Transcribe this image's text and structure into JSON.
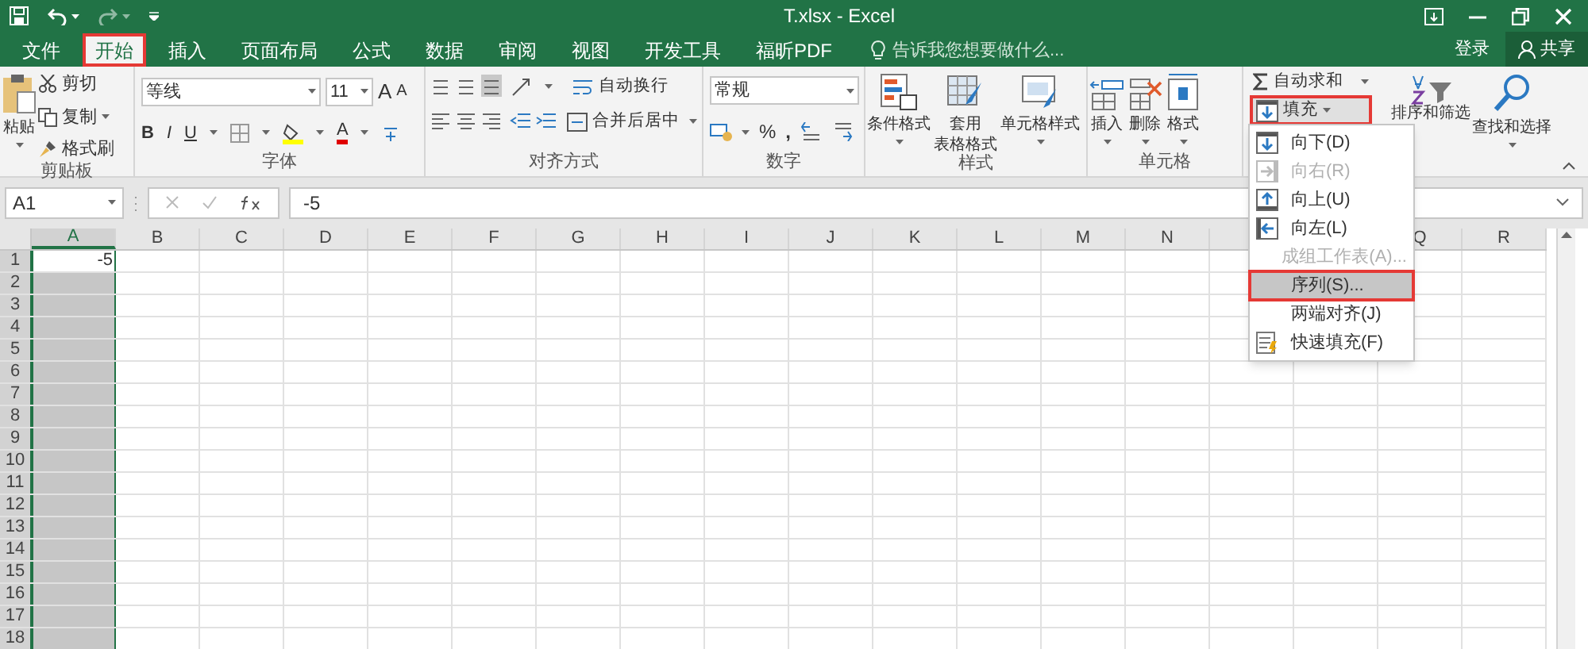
{
  "title_bar": {
    "title": "T.xlsx - Excel"
  },
  "tabs": [
    {
      "label": "文件",
      "selected": false,
      "outlined": false
    },
    {
      "label": "开始",
      "selected": true,
      "outlined": true
    },
    {
      "label": "插入",
      "selected": false,
      "outlined": false
    },
    {
      "label": "页面布局",
      "selected": false,
      "outlined": false
    },
    {
      "label": "公式",
      "selected": false,
      "outlined": false
    },
    {
      "label": "数据",
      "selected": false,
      "outlined": false
    },
    {
      "label": "审阅",
      "selected": false,
      "outlined": false
    },
    {
      "label": "视图",
      "selected": false,
      "outlined": false
    },
    {
      "label": "开发工具",
      "selected": false,
      "outlined": false
    },
    {
      "label": "福昕PDF",
      "selected": false,
      "outlined": false
    }
  ],
  "tell_me": {
    "placeholder": "告诉我您想要做什么..."
  },
  "account": {
    "sign_in": "登录",
    "share": "共享"
  },
  "ribbon": {
    "clipboard": {
      "label": "剪贴板",
      "paste": "粘贴",
      "cut": "剪切",
      "copy": "复制",
      "format_painter": "格式刷"
    },
    "font": {
      "label": "字体",
      "font_name": "等线",
      "font_size": "11",
      "grow": "A",
      "shrink": "A",
      "bold": "B",
      "italic": "I",
      "underline": "U",
      "font_color": "A"
    },
    "alignment": {
      "label": "对齐方式",
      "wrap_text": "自动换行",
      "merge_center": "合并后居中"
    },
    "number": {
      "label": "数字",
      "format": "常规",
      "percent": "%",
      "comma": ","
    },
    "styles": {
      "label": "样式",
      "conditional_formatting": "条件格式",
      "format_as_table": "套用",
      "format_as_table_2": "表格格式",
      "cell_styles": "单元格样式"
    },
    "cells": {
      "label": "单元格",
      "insert": "插入",
      "delete": "删除",
      "format": "格式"
    },
    "editing": {
      "autosum": "自动求和",
      "fill": "填充",
      "fill_outlined": true,
      "sort_filter": "排序和筛选",
      "find_select": "查找和选择"
    }
  },
  "formula_bar": {
    "name_box": "A1",
    "formula": "-5"
  },
  "sheet": {
    "columns": [
      {
        "label": "A",
        "selected": true
      },
      {
        "label": "B",
        "selected": false
      },
      {
        "label": "C",
        "selected": false
      },
      {
        "label": "D",
        "selected": false
      },
      {
        "label": "E",
        "selected": false
      },
      {
        "label": "F",
        "selected": false
      },
      {
        "label": "G",
        "selected": false
      },
      {
        "label": "H",
        "selected": false
      },
      {
        "label": "I",
        "selected": false
      },
      {
        "label": "J",
        "selected": false
      },
      {
        "label": "K",
        "selected": false
      },
      {
        "label": "L",
        "selected": false
      },
      {
        "label": "M",
        "selected": false
      },
      {
        "label": "N",
        "selected": false
      },
      {},
      {},
      {
        "label": "Q",
        "selected": false
      },
      {
        "label": "R",
        "selected": false
      }
    ],
    "rows": [
      {
        "label": "1",
        "active": true,
        "value": "-5"
      },
      {
        "label": "2",
        "active": false
      },
      {
        "label": "3",
        "active": false
      },
      {
        "label": "4",
        "active": false
      },
      {
        "label": "5",
        "active": false
      },
      {
        "label": "6",
        "active": false
      },
      {
        "label": "7",
        "active": false
      },
      {
        "label": "8",
        "active": false
      },
      {
        "label": "9",
        "active": false
      },
      {
        "label": "10",
        "active": false
      },
      {
        "label": "11",
        "active": false
      },
      {
        "label": "12",
        "active": false
      },
      {
        "label": "13",
        "active": false
      },
      {
        "label": "14",
        "active": false
      },
      {
        "label": "15",
        "active": false
      },
      {
        "label": "16",
        "active": false
      },
      {
        "label": "17",
        "active": false
      },
      {
        "label": "18",
        "active": false
      }
    ]
  },
  "fill_menu": {
    "items": [
      {
        "label": "向下(D)",
        "kind": "down",
        "disabled": false,
        "selected": false,
        "outlined": false
      },
      {
        "label": "向右(R)",
        "kind": "right",
        "disabled": true,
        "selected": false,
        "outlined": false
      },
      {
        "label": "向上(U)",
        "kind": "up",
        "disabled": false,
        "selected": false,
        "outlined": false
      },
      {
        "label": "向左(L)",
        "kind": "left",
        "disabled": false,
        "selected": false,
        "outlined": false
      },
      {
        "label": "成组工作表(A)...",
        "kind": "plain",
        "disabled": true,
        "selected": false,
        "outlined": false
      },
      {
        "label": "序列(S)...",
        "kind": "plain",
        "disabled": false,
        "selected": true,
        "outlined": true
      },
      {
        "label": "两端对齐(J)",
        "kind": "plain",
        "disabled": false,
        "selected": false,
        "outlined": false
      },
      {
        "label": "快速填充(F)",
        "kind": "flash",
        "disabled": false,
        "selected": false,
        "outlined": false
      }
    ]
  }
}
